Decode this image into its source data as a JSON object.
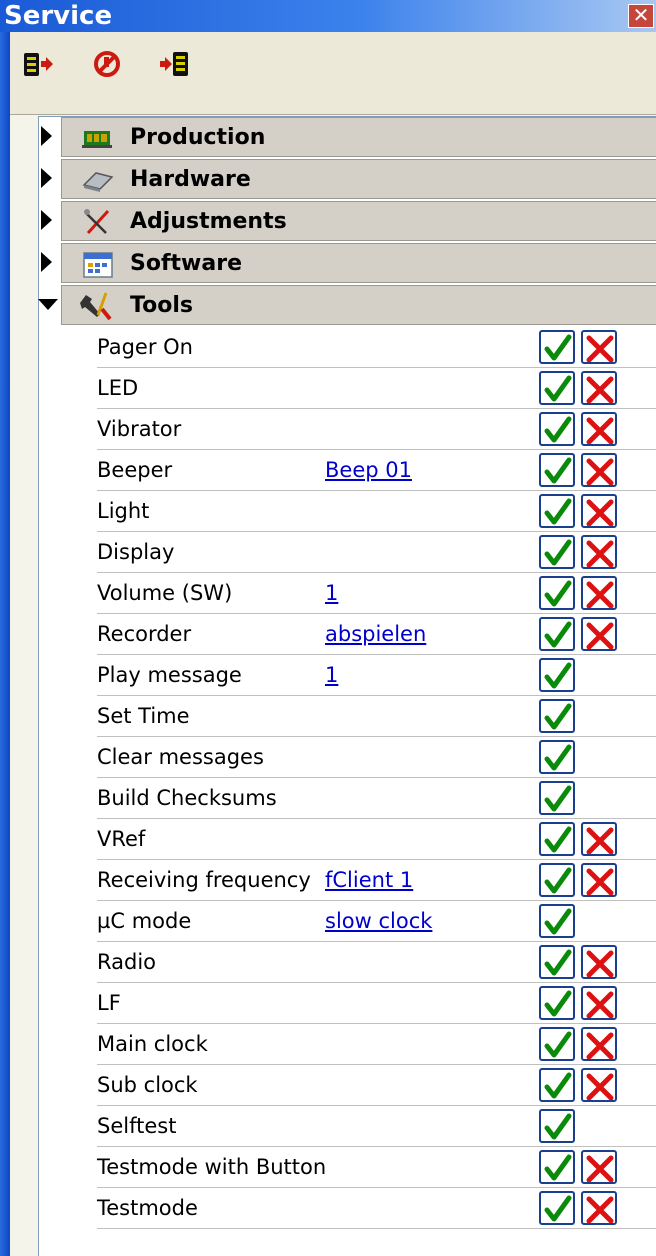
{
  "window": {
    "title": "Service",
    "close_glyph": "✕"
  },
  "toolbar": {
    "buttons": [
      {
        "icon": "export-icon"
      },
      {
        "icon": "stop-icon"
      },
      {
        "icon": "import-icon"
      }
    ]
  },
  "categories": [
    {
      "label": "Production",
      "icon": "production-icon",
      "expanded": false
    },
    {
      "label": "Hardware",
      "icon": "hardware-icon",
      "expanded": false
    },
    {
      "label": "Adjustments",
      "icon": "adjustments-icon",
      "expanded": false
    },
    {
      "label": "Software",
      "icon": "software-icon",
      "expanded": false
    },
    {
      "label": "Tools",
      "icon": "tools-icon",
      "expanded": true
    }
  ],
  "tools": [
    {
      "label": "Pager On",
      "value": "",
      "accept": true,
      "reject": true
    },
    {
      "label": "LED",
      "value": "",
      "accept": true,
      "reject": true
    },
    {
      "label": "Vibrator",
      "value": "",
      "accept": true,
      "reject": true
    },
    {
      "label": "Beeper",
      "value": "Beep 01",
      "accept": true,
      "reject": true
    },
    {
      "label": "Light",
      "value": "",
      "accept": true,
      "reject": true
    },
    {
      "label": "Display",
      "value": "",
      "accept": true,
      "reject": true
    },
    {
      "label": "Volume (SW)",
      "value": "1",
      "accept": true,
      "reject": true
    },
    {
      "label": "Recorder",
      "value": "abspielen",
      "accept": true,
      "reject": true
    },
    {
      "label": "Play message",
      "value": "1",
      "accept": true,
      "reject": false
    },
    {
      "label": "Set Time",
      "value": "",
      "accept": true,
      "reject": false
    },
    {
      "label": "Clear messages",
      "value": "",
      "accept": true,
      "reject": false
    },
    {
      "label": "Build Checksums",
      "value": "",
      "accept": true,
      "reject": false
    },
    {
      "label": "VRef",
      "value": "",
      "accept": true,
      "reject": true
    },
    {
      "label": "Receiving frequency",
      "value": "fClient 1",
      "accept": true,
      "reject": true
    },
    {
      "label": "µC mode",
      "value": "slow clock",
      "accept": true,
      "reject": false
    },
    {
      "label": "Radio",
      "value": "",
      "accept": true,
      "reject": true
    },
    {
      "label": "LF",
      "value": "",
      "accept": true,
      "reject": true
    },
    {
      "label": "Main clock",
      "value": "",
      "accept": true,
      "reject": true
    },
    {
      "label": "Sub clock",
      "value": "",
      "accept": true,
      "reject": true
    },
    {
      "label": "Selftest",
      "value": "",
      "accept": true,
      "reject": false
    },
    {
      "label": "Testmode with Button",
      "value": "",
      "accept": true,
      "reject": true
    },
    {
      "label": "Testmode",
      "value": "",
      "accept": true,
      "reject": true
    }
  ],
  "colors": {
    "titlebar": "#1a5ad6",
    "link": "#0000cc",
    "accept": "#0a8a0a",
    "reject": "#dd1111",
    "category_bg": "#d4d0c8"
  }
}
